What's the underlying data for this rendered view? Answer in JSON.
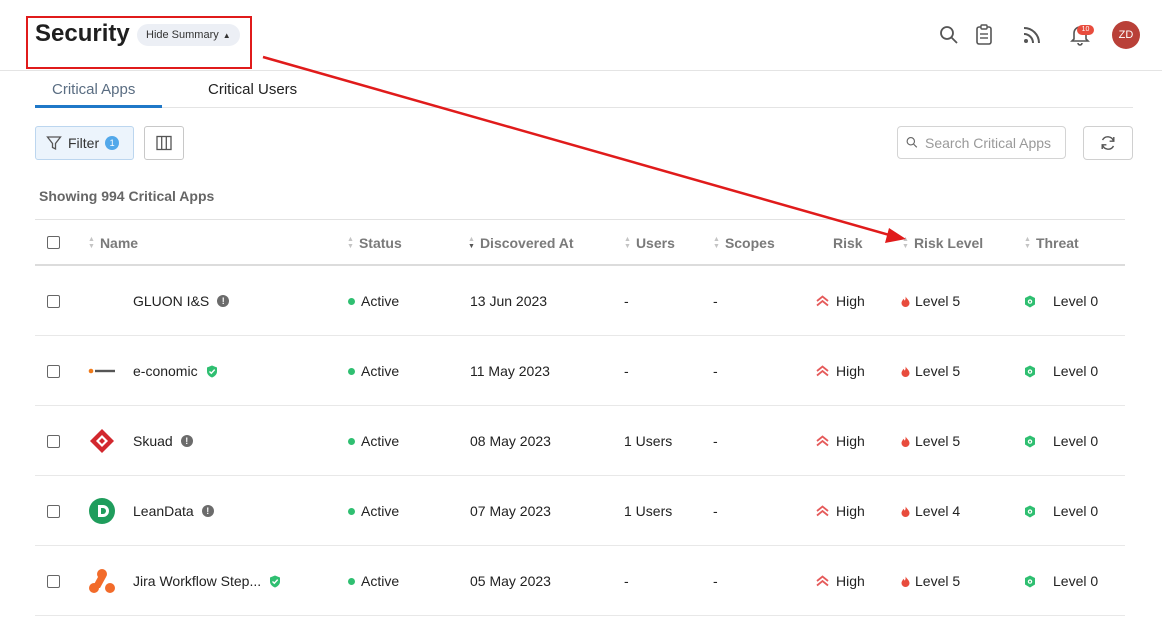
{
  "header": {
    "title": "Security",
    "hide_summary_label": "Hide Summary",
    "notification_count": "10",
    "avatar_initials": "ZD"
  },
  "tabs": [
    {
      "label": "Critical Apps",
      "active": true
    },
    {
      "label": "Critical Users",
      "active": false
    }
  ],
  "toolbar": {
    "filter_label": "Filter",
    "filter_count": "1",
    "search_placeholder": "Search Critical Apps"
  },
  "showing_text": "Showing 994 Critical Apps",
  "columns": [
    "Name",
    "Status",
    "Discovered At",
    "Users",
    "Scopes",
    "Risk",
    "Risk Level",
    "Threat"
  ],
  "rows": [
    {
      "name": "GLUON I&S",
      "badge": "info",
      "logo": "none",
      "status": "Active",
      "discovered": "13 Jun 2023",
      "users": "-",
      "scopes": "-",
      "risk": "High",
      "risk_level": "Level 5",
      "threat": "Level 0"
    },
    {
      "name": "e-conomic",
      "badge": "verified",
      "logo": "e-conomic",
      "status": "Active",
      "discovered": "11 May 2023",
      "users": "-",
      "scopes": "-",
      "risk": "High",
      "risk_level": "Level 5",
      "threat": "Level 0"
    },
    {
      "name": "Skuad",
      "badge": "info",
      "logo": "skuad",
      "status": "Active",
      "discovered": "08 May 2023",
      "users": "1 Users",
      "scopes": "-",
      "risk": "High",
      "risk_level": "Level 5",
      "threat": "Level 0"
    },
    {
      "name": "LeanData",
      "badge": "info",
      "logo": "leandata",
      "status": "Active",
      "discovered": "07 May 2023",
      "users": "1 Users",
      "scopes": "-",
      "risk": "High",
      "risk_level": "Level 4",
      "threat": "Level 0"
    },
    {
      "name": "Jira Workflow Step...",
      "badge": "verified",
      "logo": "jira",
      "status": "Active",
      "discovered": "05 May 2023",
      "users": "-",
      "scopes": "-",
      "risk": "High",
      "risk_level": "Level 5",
      "threat": "Level 0"
    }
  ],
  "colors": {
    "accent": "#1f78c8",
    "annotation_red": "#e01b1b",
    "status_active": "#2fbf71",
    "risk_high": "#e55a5a",
    "threat_green": "#2fbf71"
  }
}
